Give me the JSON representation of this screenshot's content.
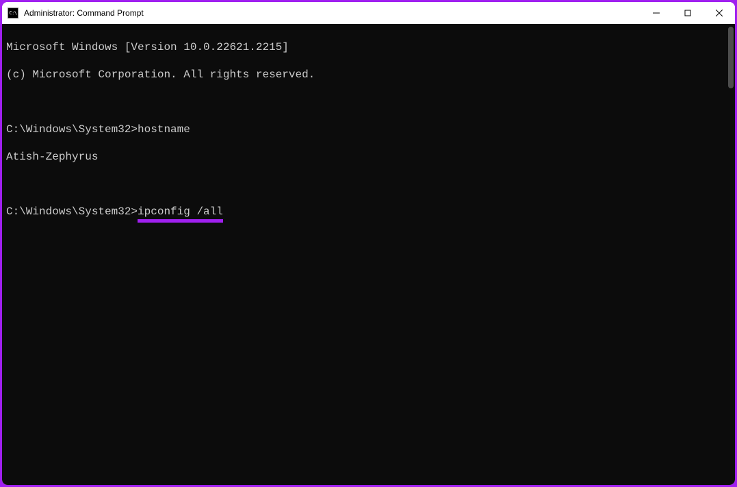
{
  "colors": {
    "accent": "#a020f0",
    "terminal_bg": "#0c0c0c",
    "terminal_fg": "#cccccc"
  },
  "window": {
    "title": "Administrator: Command Prompt"
  },
  "terminal": {
    "line1": "Microsoft Windows [Version 10.0.22621.2215]",
    "line2": "(c) Microsoft Corporation. All rights reserved.",
    "blank1": "",
    "prompt1": "C:\\Windows\\System32>",
    "cmd1": "hostname",
    "output1": "Atish-Zephyrus",
    "blank2": "",
    "prompt2": "C:\\Windows\\System32>",
    "cmd2": "ipconfig /all"
  }
}
